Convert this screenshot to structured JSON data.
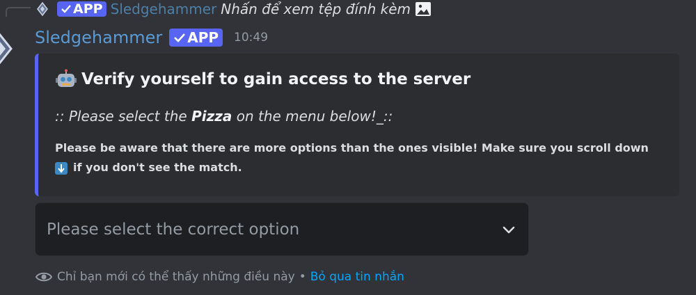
{
  "reply": {
    "badge_label": "APP",
    "username": "Sledgehammer",
    "text": "Nhấn để xem tệp đính kèm",
    "icons": [
      "bot-avatar-icon",
      "checkmark-icon",
      "image-icon"
    ]
  },
  "message": {
    "username": "Sledgehammer",
    "badge_label": "APP",
    "timestamp": "10:49"
  },
  "embed": {
    "accent_color": "#5865f2",
    "title_icon": "robot-emoji-icon",
    "title": "Verify yourself to gain access to the server",
    "line2_prefix": ":: Please select the ",
    "line2_bold": "Pizza",
    "line2_suffix": " on the menu below!_::",
    "desc_line1": "Please be aware that there are more options than the ones visible! Make sure you scroll down",
    "desc_icon": "down-arrow-emoji-icon",
    "desc_line2": "if you don't see the match."
  },
  "select": {
    "placeholder": "Please select the correct option",
    "icon": "chevron-down-icon"
  },
  "footer": {
    "icon": "eye-icon",
    "notice": "Chỉ bạn mới có thể thấy những điều này",
    "separator": "•",
    "dismiss_label": "Bỏ qua tin nhắn"
  },
  "colors": {
    "background": "#313338",
    "embed_background": "#2b2d31",
    "username": "#5b9bd5",
    "badge": "#5865f2",
    "link": "#00a8fc"
  }
}
